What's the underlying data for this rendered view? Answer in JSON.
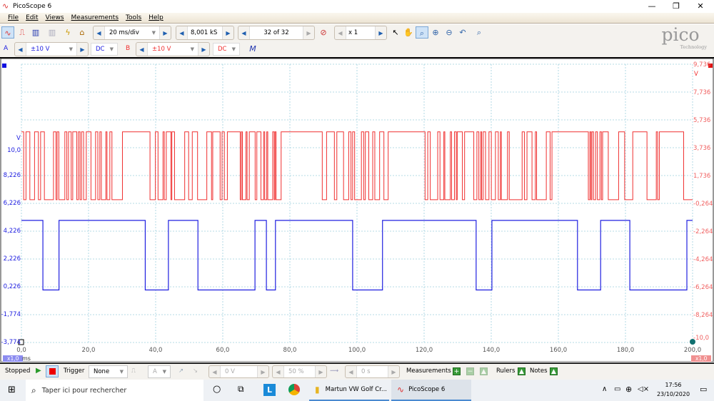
{
  "window": {
    "title": "PicoScope 6",
    "minimize": "—",
    "restore": "❐",
    "close": "✕"
  },
  "menu": [
    "File",
    "Edit",
    "Views",
    "Measurements",
    "Tools",
    "Help"
  ],
  "toolbar": {
    "timebase": "20 ms/div",
    "samples": "8,001 kS",
    "buffer": "32 of 32",
    "zoom": "x 1"
  },
  "channels": {
    "a": {
      "label": "A",
      "range": "±10 V",
      "coupling": "DC",
      "color": "#2020e0"
    },
    "b": {
      "label": "B",
      "range": "±10 V",
      "coupling": "DC",
      "color": "#f03030"
    }
  },
  "logo": {
    "text": "pico",
    "sub": "Technology"
  },
  "axes": {
    "left_unit": "V",
    "left_ticks": [
      "10,0",
      "8,226",
      "6,226",
      "4,226",
      "2,226",
      "0,226",
      "-1,774",
      "-3,774"
    ],
    "right_unit": "V",
    "right_ticks": [
      "9,736",
      "7,736",
      "5,736",
      "3,736",
      "1,736",
      "-0,264",
      "-2,264",
      "-4,264",
      "-6,264",
      "-8,264",
      "-10,0"
    ],
    "x_ticks": [
      "0,0",
      "20,0",
      "40,0",
      "60,0",
      "80,0",
      "100,0",
      "120,0",
      "140,0",
      "160,0",
      "180,0",
      "200,0"
    ],
    "x_unit": "ms",
    "x_zoom": "x1,0",
    "right_zoom": "x1,0"
  },
  "chart_data": {
    "type": "line",
    "x_range_ms": [
      0,
      200
    ],
    "channel_a": {
      "high_v": 5.0,
      "low_v": 0.0,
      "start_level": "high",
      "transitions_ms": [
        6.4,
        11.2,
        36.9,
        43.8,
        52.6,
        69.6,
        73.0,
        75.7,
        98.7,
        107.6,
        135.5,
        140.2,
        165.7,
        172.6,
        181.3,
        198.3
      ]
    },
    "channel_b": {
      "high_v": 4.88,
      "low_v": 0.0,
      "idle_high_ms": [
        [
          29.4,
          38.1
        ],
        [
          77.3,
          89.4
        ],
        [
          108.7,
          119.6
        ],
        [
          157.9,
          168.1
        ],
        [
          190.2,
          196.8
        ]
      ]
    }
  },
  "status": {
    "run_state": "Stopped",
    "trigger_label": "Trigger",
    "trigger_mode": "None",
    "trig_channel": "A",
    "threshold": "0 V",
    "pretrigger": "50 %",
    "delay": "0 s",
    "measurements": "Measurements",
    "rulers": "Rulers",
    "notes": "Notes"
  },
  "taskbar": {
    "search_placeholder": "Taper ici pour rechercher",
    "app1": "Martun VW Golf Cr...",
    "app2": "PicoScope 6",
    "time": "17:56",
    "date": "23/10/2020"
  }
}
